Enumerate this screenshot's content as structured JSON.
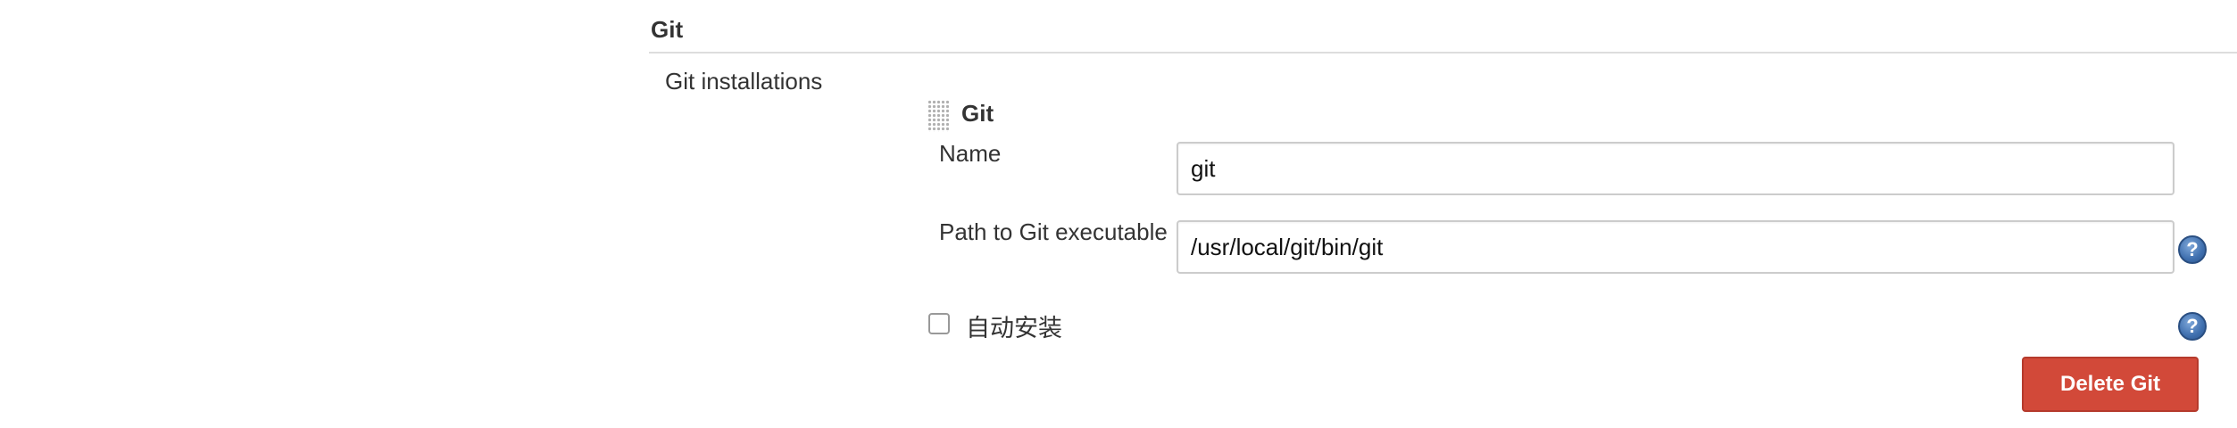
{
  "section": {
    "title": "Git"
  },
  "installations": {
    "label": "Git installations",
    "item": {
      "title": "Git",
      "fields": {
        "name": {
          "label": "Name",
          "value": "git"
        },
        "path": {
          "label": "Path to Git executable",
          "value": "/usr/local/git/bin/git",
          "help_symbol": "?"
        }
      },
      "auto_install": {
        "label": "自动安装",
        "checked": false,
        "help_symbol": "?"
      },
      "delete_button": {
        "label": "Delete Git"
      }
    }
  },
  "colors": {
    "delete_button_bg": "#d24939",
    "help_icon": "#3f6fae",
    "divider": "#dddddd"
  },
  "icons": {
    "drag_handle": "drag-handle-icon",
    "help": "help-icon",
    "checkbox": "checkbox-unchecked"
  }
}
